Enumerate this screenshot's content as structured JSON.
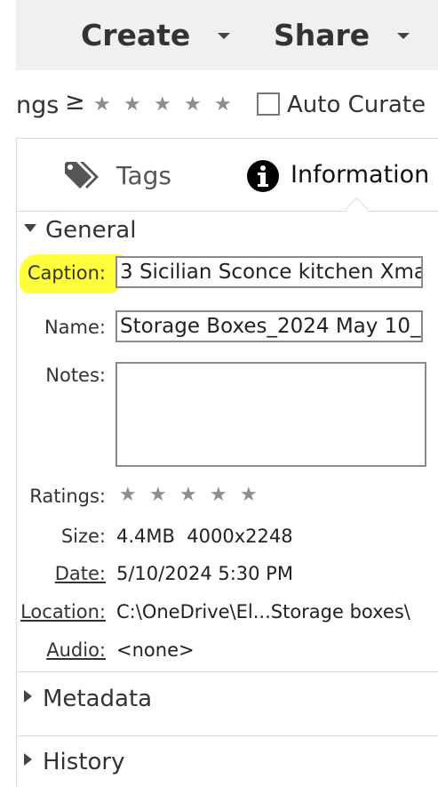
{
  "toolbar": {
    "create_label": "Create",
    "share_label": "Share"
  },
  "filter": {
    "ratings_label": "ngs",
    "ge_symbol": "≥",
    "auto_curate_label": "Auto Curate",
    "auto_curate_checked": false
  },
  "tabs": {
    "tags_label": "Tags",
    "information_label": "Information",
    "active": "Information"
  },
  "general": {
    "header": "General",
    "caption_label": "Caption:",
    "caption_value": "3 Sicilian Sconce kitchen Xma",
    "name_label": "Name:",
    "name_value": "Storage Boxes_2024 May 10_",
    "notes_label": "Notes:",
    "notes_value": "",
    "ratings_label": "Ratings:",
    "rating_value": 0,
    "size_label": "Size:",
    "size_value": "4.4MB  4000x2248",
    "date_label": "Date:",
    "date_value": "5/10/2024 5:30 PM",
    "location_label": "Location:",
    "location_value": "C:\\OneDrive\\El...Storage boxes\\",
    "audio_label": "Audio:",
    "audio_value": "<none>"
  },
  "sections": {
    "metadata_header": "Metadata",
    "history_header": "History"
  },
  "icons": {
    "star_glyph": "★",
    "star_color": "#8d8d8d"
  }
}
